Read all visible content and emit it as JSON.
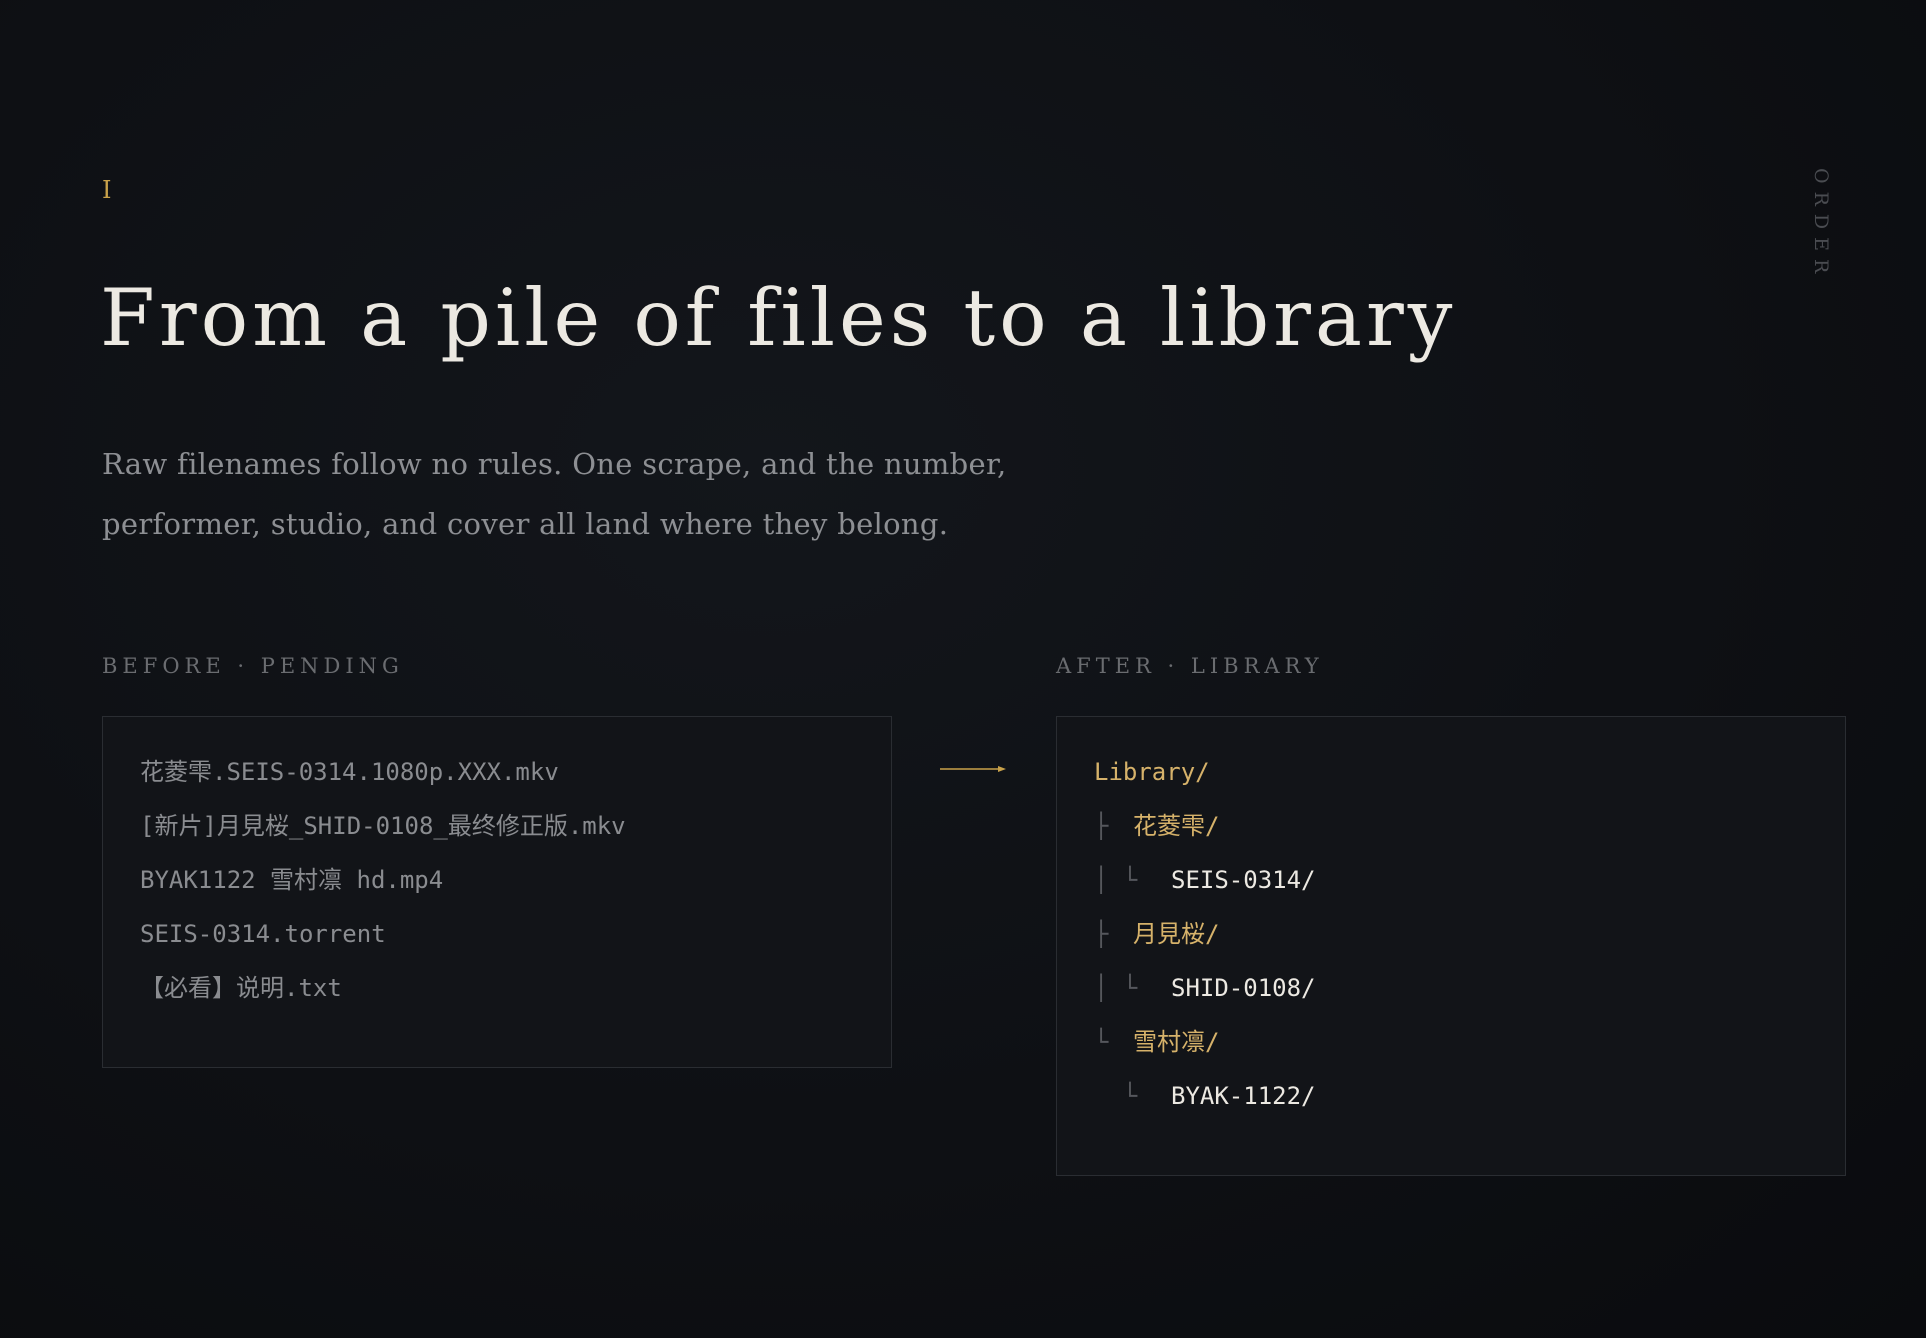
{
  "section": {
    "numeral": "I",
    "side_label": "ORDER",
    "title": "From a pile of files to a library",
    "subtitle": "Raw filenames follow no rules. One scrape, and the number, performer, studio, and cover all land where they belong."
  },
  "before": {
    "label": "BEFORE · PENDING",
    "files": [
      "花菱雫.SEIS-0314.1080p.XXX.mkv",
      "[新片]月見桜_SHID-0108_最终修正版.mkv",
      "BYAK1122 雪村凛 hd.mp4",
      "SEIS-0314.torrent",
      "【必看】说明.txt"
    ]
  },
  "after": {
    "label": "AFTER · LIBRARY",
    "root": "Library/",
    "tree": [
      {
        "branch": "├",
        "name": "花菱雫/",
        "kind": "folder"
      },
      {
        "branch": "│ └",
        "name": "SEIS-0314/",
        "kind": "code"
      },
      {
        "branch": "├",
        "name": "月見桜/",
        "kind": "folder"
      },
      {
        "branch": "│ └",
        "name": "SHID-0108/",
        "kind": "code"
      },
      {
        "branch": "└",
        "name": "雪村凛/",
        "kind": "folder"
      },
      {
        "branch": "  └",
        "name": "BYAK-1122/",
        "kind": "code"
      }
    ]
  },
  "colors": {
    "accent": "#c9a24a",
    "folder": "#d6b26a",
    "background": "#0e1014",
    "panel": "#121418"
  }
}
